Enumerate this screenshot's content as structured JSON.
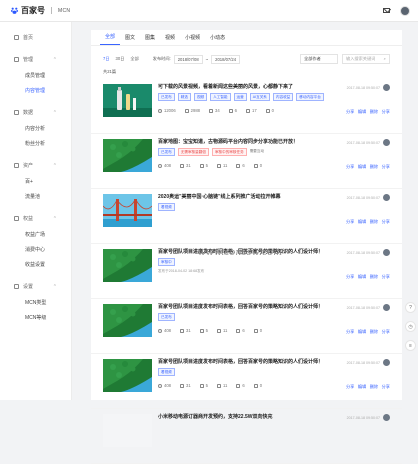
{
  "topbar": {
    "brand": "百家号",
    "sub": "MCN"
  },
  "sidebar": {
    "home": "首页",
    "groups": [
      {
        "label": "管理",
        "items": [
          "成员管理",
          "内容管理"
        ],
        "active": 1
      },
      {
        "label": "数据",
        "items": [
          "内容分析",
          "粉丝分析"
        ],
        "active": -1
      },
      {
        "label": "资产",
        "items": [
          "百+",
          "流量池"
        ],
        "active": -1
      },
      {
        "label": "权益",
        "items": [
          "权益广场",
          "消费中心",
          "收益设置"
        ],
        "active": -1
      },
      {
        "label": "设置",
        "items": [
          "MCN类型",
          "MCN等级"
        ],
        "active": -1
      }
    ]
  },
  "tabs": [
    "全部",
    "图文",
    "图集",
    "视频",
    "小视频",
    "小动态"
  ],
  "filters": {
    "options": [
      "7日",
      "30日",
      "全部"
    ],
    "date_label": "发布时间:",
    "start": "2018/07/08",
    "sep": "~",
    "end": "2018/07/24",
    "select": "全部作者",
    "search_placeholder": "输入搜索关键词"
  },
  "count_text": "共21篇",
  "articles": [
    {
      "title": "可下载的风景视频，看着新闻这些美丽的风景，心都静下来了",
      "tags": [
        "已发布",
        "精选",
        "视频",
        "人工智能",
        "运营",
        "AI互关系",
        "内容收益",
        "移动内容平台"
      ],
      "tag_styles": [
        "",
        "",
        "",
        "",
        "",
        "",
        "",
        ""
      ],
      "date": "2017-08-18 09:50:07",
      "stats": [
        "12006",
        "2988",
        "34",
        "6",
        "17",
        "0"
      ],
      "actions": [
        "分享",
        "编辑",
        "删除",
        "分享"
      ],
      "thumb": "bottle"
    },
    {
      "title": "百家地图：宝宝知道，古物源码平台内容同步分享功能已开放！",
      "tags": [
        "已发布",
        "无需审核量翻倍",
        "审核中的审核任务",
        "需要互动"
      ],
      "tag_styles": [
        "",
        "red",
        "red",
        "gray"
      ],
      "date": "2017-08-18 09:50:07",
      "stats": [
        "408",
        "31",
        "5",
        "11",
        "6",
        "0"
      ],
      "actions": [
        "分享",
        "编辑",
        "删除",
        "分享"
      ],
      "thumb": "forest"
    },
    {
      "title": "2020奥运\"美丽中国·心脑链\"线上系列推广活动拉开帷幕",
      "tags": [
        "看视频"
      ],
      "tag_styles": [
        ""
      ],
      "date": "2017-08-18 09:50:07",
      "stats": [],
      "actions": [
        "分享",
        "编辑",
        "删除",
        "分享"
      ],
      "thumb": "bridge"
    },
    {
      "title": "百家号团队项目进度发布时间表格，回答百家号的策略知识的人们设计师！",
      "tags": [
        "审核中"
      ],
      "tag_styles": [
        ""
      ],
      "date": "2017-08-18 09:50:07",
      "desc": "发布于2018-04-02 18:68发布",
      "stats": [],
      "actions": [
        "分享",
        "编辑",
        "删除",
        "分享"
      ],
      "thumb": "forest"
    },
    {
      "title": "百家号团队项目进度发布时间表格，回答百家号的策略知识的人们设计师！",
      "tags": [
        "已发布"
      ],
      "tag_styles": [
        ""
      ],
      "date": "2017-08-18 09:50:07",
      "stats": [
        "408",
        "31",
        "5",
        "11",
        "6",
        "0"
      ],
      "actions": [
        "分享",
        "编辑",
        "删除",
        "分享"
      ],
      "thumb": "forest"
    },
    {
      "title": "百家号团队项目进度发布时间表格，回答百家号的策略知识的人们设计师！",
      "tags": [
        "看视频"
      ],
      "tag_styles": [
        ""
      ],
      "date": "2017-08-18 09:50:07",
      "stats": [
        "408",
        "31",
        "5",
        "11",
        "6",
        "0"
      ],
      "actions": [
        "分享",
        "编辑",
        "删除",
        "分享"
      ],
      "thumb": "forest"
    },
    {
      "title": "小米移动电源订器商开发预约，支持22.5W双向快充",
      "tags": [],
      "tag_styles": [],
      "date": "2017-08-18 09:50:07",
      "stats": [],
      "actions": [],
      "thumb": "blank"
    }
  ],
  "watermark": "www.zonzsw.com",
  "floaters": [
    "?",
    "◷",
    "≡"
  ]
}
